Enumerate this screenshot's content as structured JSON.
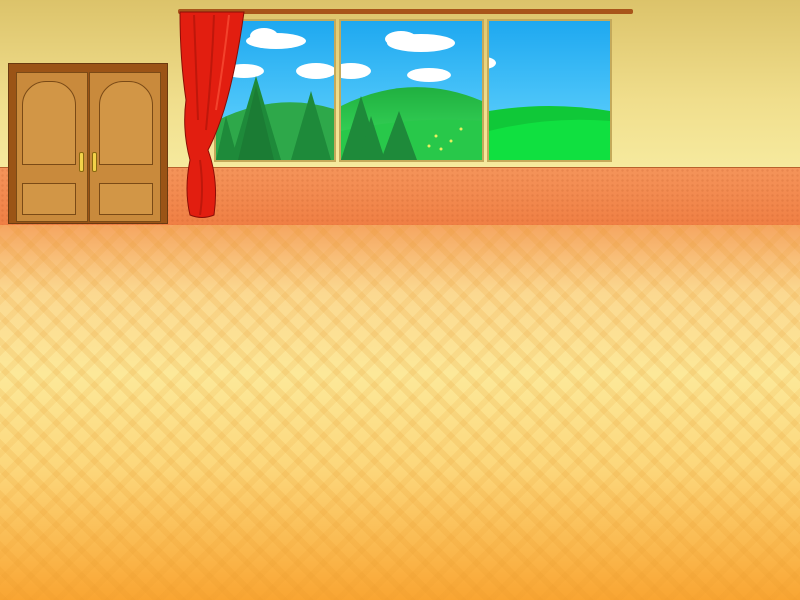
{
  "scene": {
    "type": "room-interior",
    "elements": {
      "wall": {
        "color": "#f0de8c"
      },
      "wainscot": {
        "color": "#f07f44"
      },
      "floor": {
        "pattern": "herringbone-parquet",
        "color": "#fce898"
      },
      "door": {
        "type": "double-wooden-door",
        "color": "#c98a3c"
      },
      "window": {
        "panes": 3,
        "view": "landscape-with-pine-trees-and-hills",
        "frame_color": "#c4a95a"
      },
      "curtain": {
        "color": "#e21e10",
        "side": "left"
      },
      "curtain_rod": {
        "color": "#a8551a"
      }
    },
    "colors": {
      "sky_top": "#1ea8f0",
      "sky_bottom": "#6ad8ff",
      "grass": "#10e040",
      "hill": "#1fb040",
      "trees": "#1e8a3a"
    }
  }
}
